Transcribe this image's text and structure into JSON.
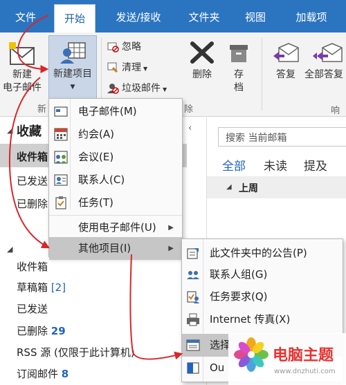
{
  "tabs": [
    {
      "label": "文件"
    },
    {
      "label": "开始"
    },
    {
      "label": "发送/接收"
    },
    {
      "label": "文件夹"
    },
    {
      "label": "视图"
    },
    {
      "label": "加载项"
    }
  ],
  "ribbon": {
    "new_email": "新建\n电子邮件",
    "new_items": "新建项目",
    "group_new": "新",
    "group_delete_tail": "除",
    "group_respond": "响应",
    "ignore": "忽略",
    "cleanup": "清理",
    "junk": "垃圾邮件",
    "delete": "删除",
    "archive": "存\n档",
    "reply": "答复",
    "reply_all": "全部答复"
  },
  "folders": {
    "favorites_header": "收藏",
    "fav_items": [
      "收件箱",
      "已发送",
      "已删除"
    ],
    "items": [
      {
        "label": "收件箱",
        "count": ""
      },
      {
        "label": "草稿箱",
        "count": "[2]"
      },
      {
        "label": "已发送",
        "count": ""
      },
      {
        "label": "已删除",
        "count": "29"
      },
      {
        "label": "RSS 源 (仅限于此计算机)",
        "count": ""
      },
      {
        "label": "订阅邮件",
        "count": "8"
      }
    ]
  },
  "messagelist": {
    "search_placeholder": "搜索 当前邮箱",
    "filter_all": "全部",
    "filter_unread": "未读",
    "filter_mention": "提及",
    "group_header": "上周"
  },
  "new_items_menu": {
    "items": [
      {
        "label": "电子邮件(M)",
        "icon": "email-icon"
      },
      {
        "label": "约会(A)",
        "icon": "calendar-icon"
      },
      {
        "label": "会议(E)",
        "icon": "meeting-icon"
      },
      {
        "label": "联系人(C)",
        "icon": "contact-icon"
      },
      {
        "label": "任务(T)",
        "icon": "task-icon"
      }
    ],
    "use_email": "使用电子邮件(U)",
    "more_items": "其他项目(I)"
  },
  "more_items_menu": {
    "items": [
      {
        "label": "此文件夹中的公告(P)",
        "icon": "post-icon"
      },
      {
        "label": "联系人组(G)",
        "icon": "contact-group-icon"
      },
      {
        "label": "任务要求(Q)",
        "icon": "task-request-icon"
      },
      {
        "label": "Internet 传真(X)",
        "icon": "fax-icon"
      },
      {
        "label": "选择",
        "icon": "form-icon"
      },
      {
        "label": "Ou",
        "icon": "outlook-icon"
      }
    ]
  },
  "watermark": {
    "text": "电脑主题",
    "url": "www.dnzhuti.com"
  },
  "colors": {
    "tabbar": "#2b74c0",
    "accent": "#1f63c4",
    "annotation": "#d9262a"
  }
}
